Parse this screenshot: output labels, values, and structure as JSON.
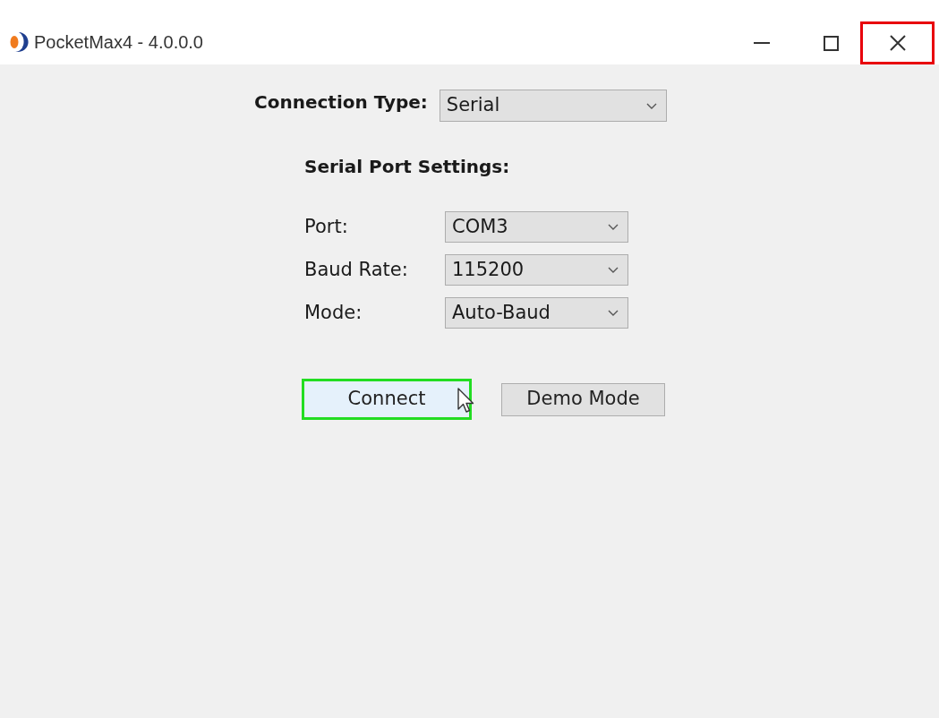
{
  "window": {
    "title": "PocketMax4 - 4.0.0.0",
    "controls": [
      {
        "kind": "minimize",
        "highlighted": false
      },
      {
        "kind": "maximize",
        "highlighted": false
      },
      {
        "kind": "close",
        "highlighted": true
      }
    ]
  },
  "connection_type": {
    "label": "Connection Type:",
    "value": "Serial"
  },
  "serial_port_settings": {
    "heading": "Serial Port Settings:",
    "fields": [
      {
        "label": "Port:",
        "value": "COM3"
      },
      {
        "label": "Baud Rate:",
        "value": "115200"
      },
      {
        "label": "Mode:",
        "value": "Auto-Baud"
      }
    ]
  },
  "buttons": [
    {
      "label": "Connect",
      "highlighted": true,
      "hovered": true
    },
    {
      "label": "Demo Mode",
      "highlighted": false,
      "hovered": false
    }
  ]
}
